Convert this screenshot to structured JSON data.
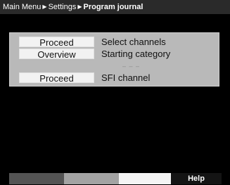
{
  "breadcrumb": {
    "items": [
      "Main Menu",
      "Settings",
      "Program journal"
    ],
    "separator": "▶"
  },
  "panel": {
    "rows": [
      {
        "button": "Proceed",
        "label": "Select channels"
      },
      {
        "button": "Overview",
        "label": "Starting category"
      },
      {
        "button": "Proceed",
        "label": "SFI channel"
      }
    ],
    "divider": "– – –"
  },
  "footer": {
    "help_label": "Help"
  },
  "colors": {
    "background": "#000000",
    "titlebar": "#2a2a2a",
    "panel": "#b9b9b9",
    "button": "#f2f2f2"
  }
}
